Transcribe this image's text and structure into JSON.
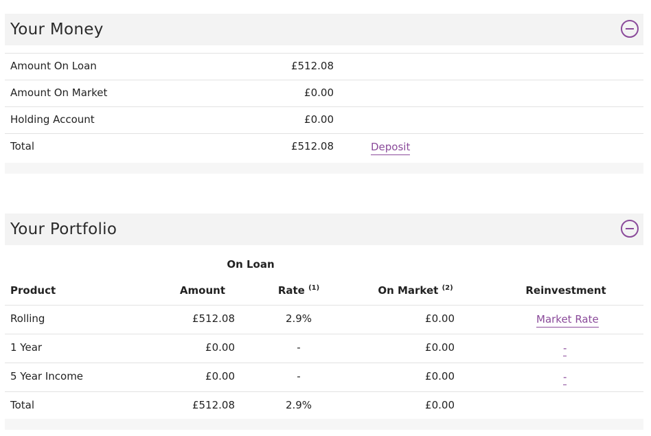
{
  "money": {
    "title": "Your Money",
    "rows": [
      {
        "label": "Amount On Loan",
        "value": "£512.08"
      },
      {
        "label": "Amount On Market",
        "value": "£0.00"
      },
      {
        "label": "Holding Account",
        "value": "£0.00"
      },
      {
        "label": "Total",
        "value": "£512.08",
        "action": "Deposit"
      }
    ]
  },
  "portfolio": {
    "title": "Your Portfolio",
    "group_header": "On Loan",
    "headers": {
      "product": "Product",
      "amount": "Amount",
      "rate": "Rate",
      "rate_note": "(1)",
      "on_market": "On Market",
      "on_market_note": "(2)",
      "reinvestment": "Reinvestment"
    },
    "rows": [
      {
        "product": "Rolling",
        "amount": "£512.08",
        "rate": "2.9%",
        "on_market": "£0.00",
        "reinvestment": "Market Rate"
      },
      {
        "product": "1 Year",
        "amount": "£0.00",
        "rate": "-",
        "on_market": "£0.00",
        "reinvestment": "-"
      },
      {
        "product": "5 Year Income",
        "amount": "£0.00",
        "rate": "-",
        "on_market": "£0.00",
        "reinvestment": "-"
      },
      {
        "product": "Total",
        "amount": "£512.08",
        "rate": "2.9%",
        "on_market": "£0.00",
        "reinvestment": ""
      }
    ]
  },
  "colors": {
    "accent": "#8a4a9a",
    "header_bg": "#f3f3f3",
    "divider": "#e2e2e2"
  },
  "icons": {
    "collapse": "minus-circle-icon"
  }
}
